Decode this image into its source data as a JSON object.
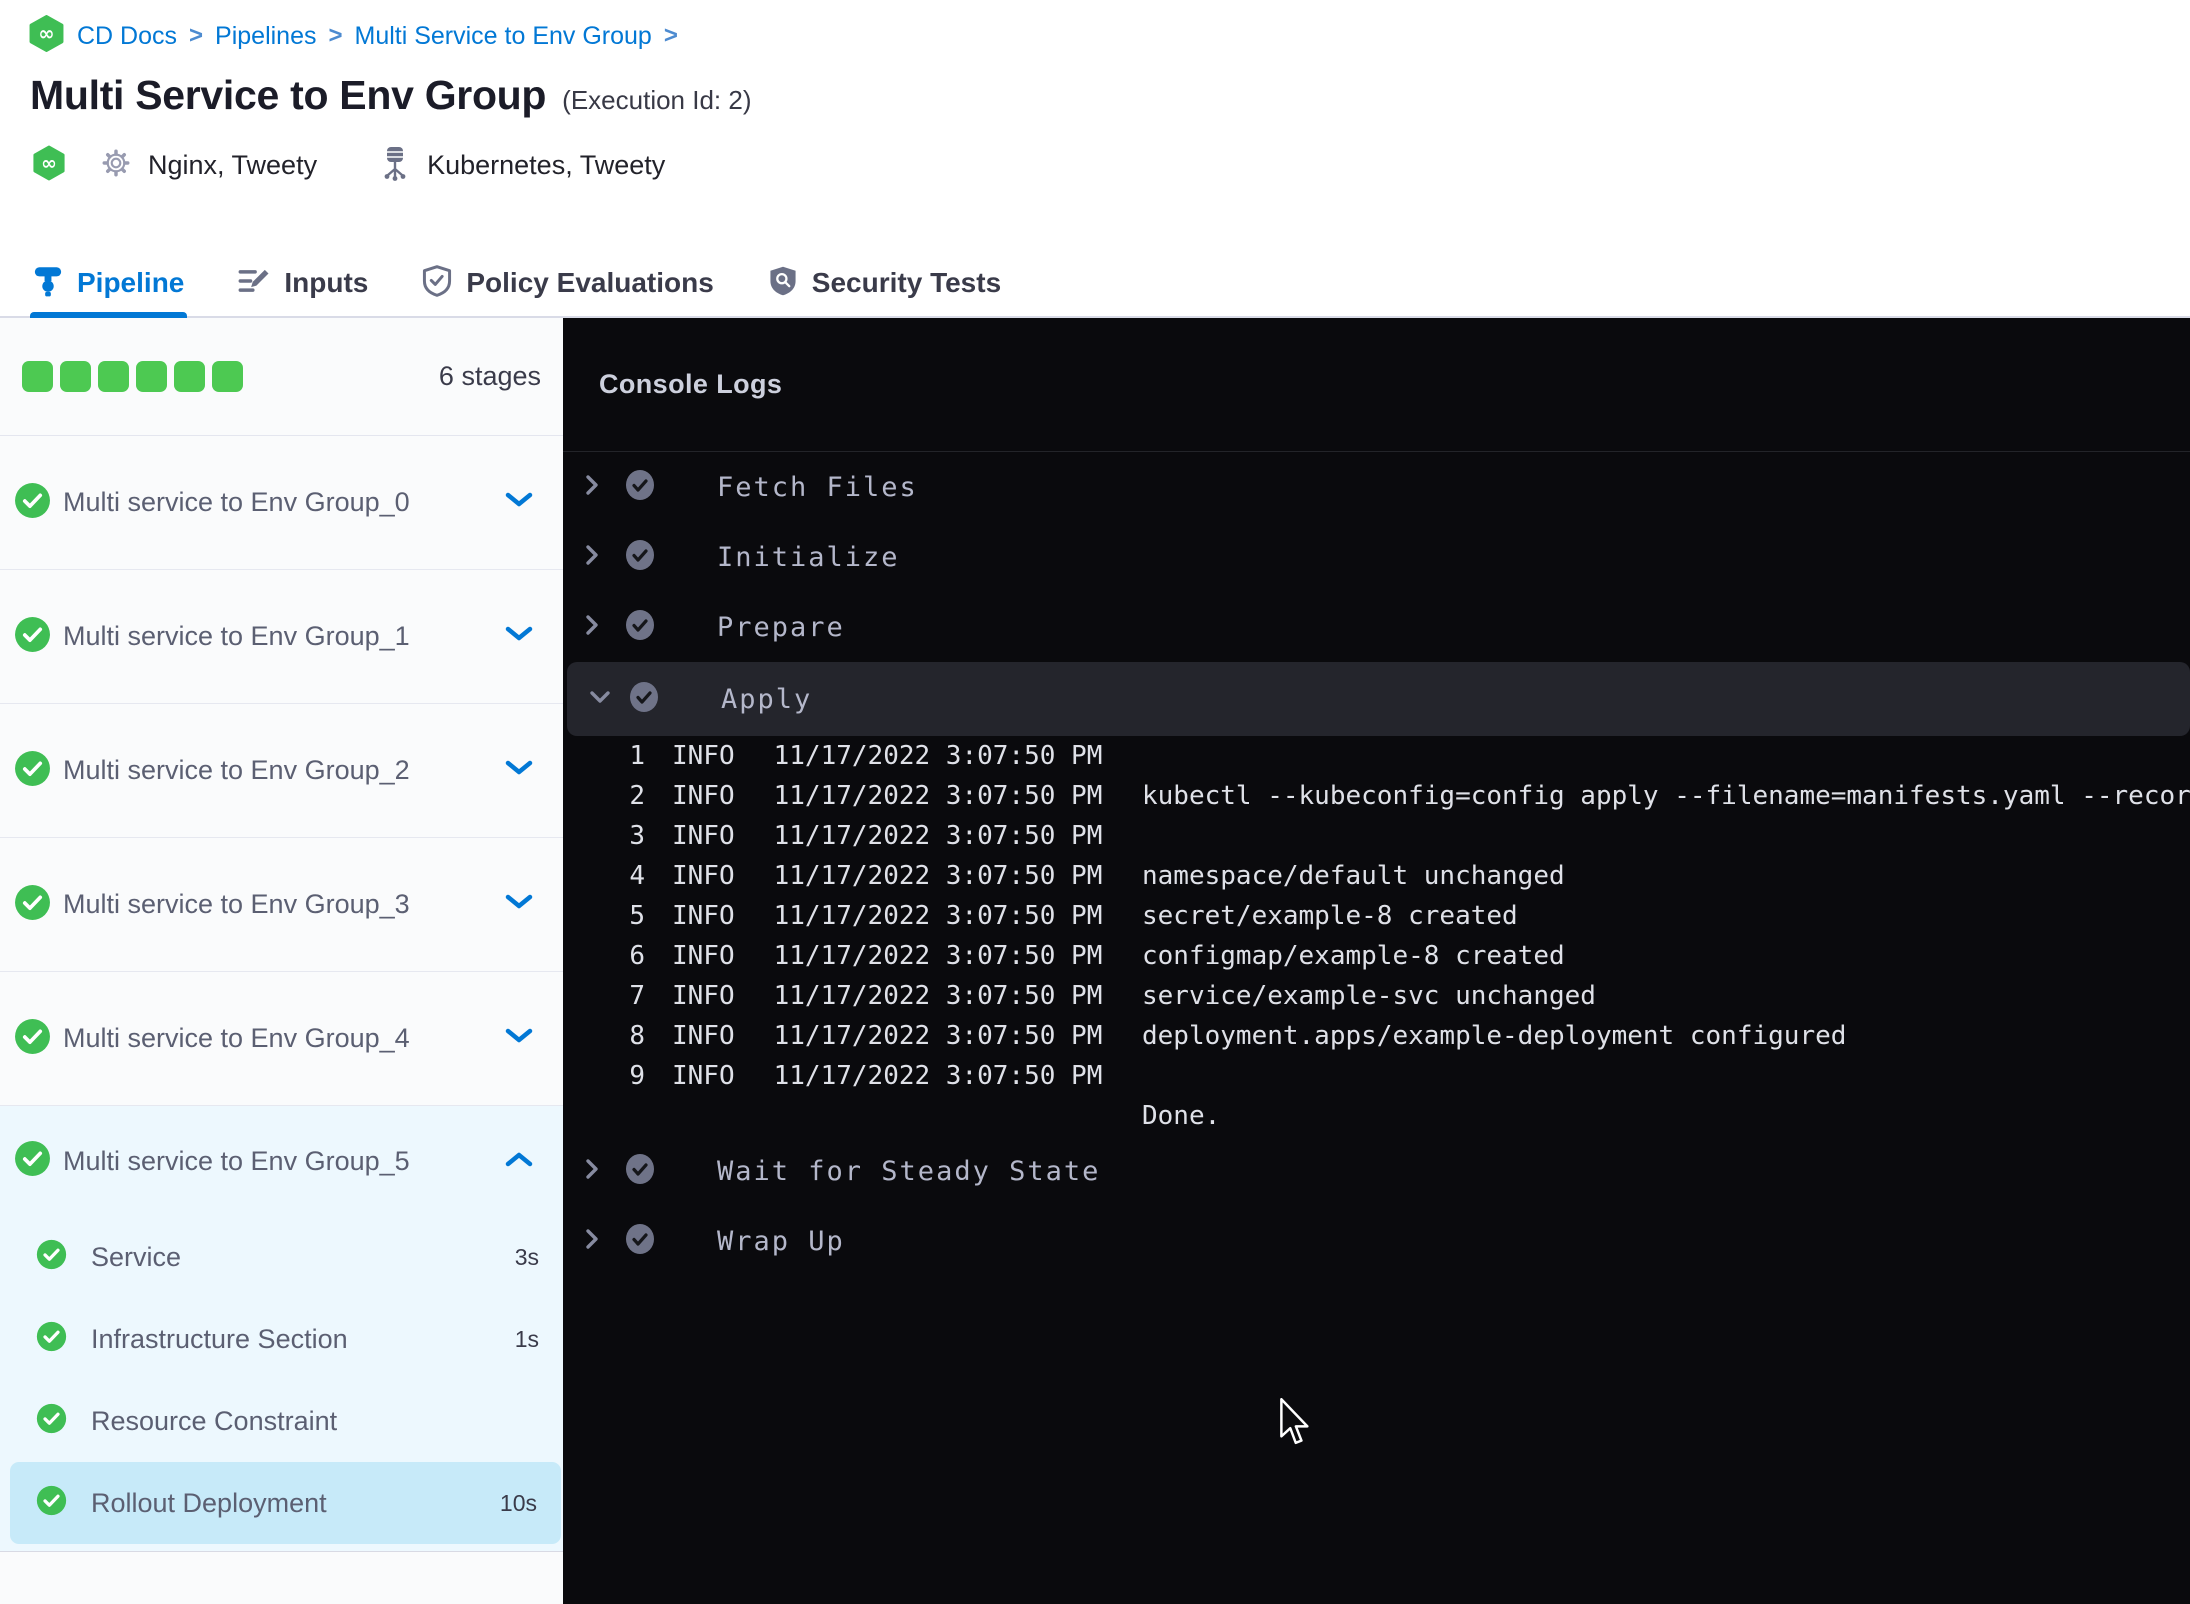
{
  "colors": {
    "primary_blue": "#0278D5",
    "success_green": "#4DC952",
    "console_bg": "#0A0A0D",
    "selected_row": "#C7EAF9"
  },
  "breadcrumb": {
    "items": [
      "CD Docs",
      "Pipelines",
      "Multi Service to Env Group"
    ],
    "separator": ">"
  },
  "header": {
    "title": "Multi Service to Env Group",
    "execution_id": "(Execution Id: 2)",
    "services": "Nginx, Tweety",
    "environments": "Kubernetes, Tweety"
  },
  "tabs": [
    {
      "label": "Pipeline"
    },
    {
      "label": "Inputs"
    },
    {
      "label": "Policy Evaluations"
    },
    {
      "label": "Security Tests"
    }
  ],
  "stages": {
    "count_label": "6 stages",
    "items": [
      "Multi service to Env Group_0",
      "Multi service to Env Group_1",
      "Multi service to Env Group_2",
      "Multi service to Env Group_3",
      "Multi service to Env Group_4",
      "Multi service to Env Group_5"
    ],
    "substeps": [
      {
        "label": "Service",
        "duration": "3s"
      },
      {
        "label": "Infrastructure Section",
        "duration": "1s"
      },
      {
        "label": "Resource Constraint",
        "duration": ""
      },
      {
        "label": "Rollout Deployment",
        "duration": "10s"
      }
    ]
  },
  "console": {
    "title": "Console Logs",
    "steps_before": [
      "Fetch Files",
      "Initialize",
      "Prepare"
    ],
    "expanded_step": "Apply",
    "steps_after": [
      "Wait for Steady State",
      "Wrap Up"
    ],
    "logs": [
      {
        "n": "1",
        "level": "INFO",
        "ts": "11/17/2022 3:07:50 PM",
        "msg": ""
      },
      {
        "n": "2",
        "level": "INFO",
        "ts": "11/17/2022 3:07:50 PM",
        "msg": "kubectl --kubeconfig=config apply --filename=manifests.yaml --record"
      },
      {
        "n": "3",
        "level": "INFO",
        "ts": "11/17/2022 3:07:50 PM",
        "msg": ""
      },
      {
        "n": "4",
        "level": "INFO",
        "ts": "11/17/2022 3:07:50 PM",
        "msg": "namespace/default unchanged"
      },
      {
        "n": "5",
        "level": "INFO",
        "ts": "11/17/2022 3:07:50 PM",
        "msg": "secret/example-8 created"
      },
      {
        "n": "6",
        "level": "INFO",
        "ts": "11/17/2022 3:07:50 PM",
        "msg": "configmap/example-8 created"
      },
      {
        "n": "7",
        "level": "INFO",
        "ts": "11/17/2022 3:07:50 PM",
        "msg": "service/example-svc unchanged"
      },
      {
        "n": "8",
        "level": "INFO",
        "ts": "11/17/2022 3:07:50 PM",
        "msg": "deployment.apps/example-deployment configured"
      },
      {
        "n": "9",
        "level": "INFO",
        "ts": "11/17/2022 3:07:50 PM",
        "msg": ""
      }
    ],
    "done": "Done."
  }
}
